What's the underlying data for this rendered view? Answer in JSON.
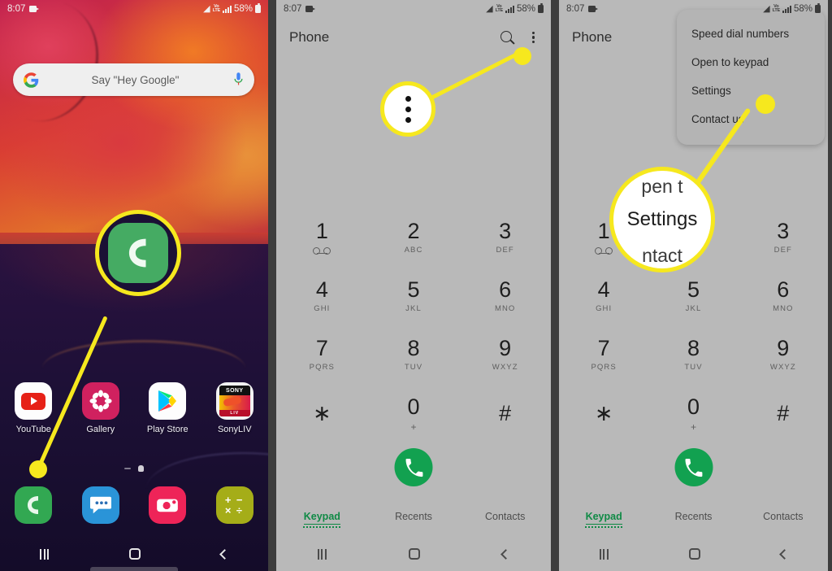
{
  "status_bar": {
    "time": "8:07",
    "battery_percent": "58%",
    "icons": [
      "camera-icon",
      "wifi-icon",
      "volte-icon",
      "signal-bars-icon",
      "battery-icon"
    ],
    "volte_top": "Vo",
    "volte_bottom": "LTE"
  },
  "panel1": {
    "name": "home-screen",
    "search": {
      "placeholder": "Say \"Hey Google\"",
      "logo": "google-g-icon",
      "mic": "microphone-icon"
    },
    "apps": [
      {
        "label": "YouTube",
        "icon": "youtube-icon"
      },
      {
        "label": "Gallery",
        "icon": "gallery-icon"
      },
      {
        "label": "Play Store",
        "icon": "play-store-icon"
      },
      {
        "label": "SonyLIV",
        "icon": "sonyliv-icon"
      }
    ],
    "sonyliv": {
      "top": "SONY",
      "bottom": "LIV"
    },
    "dock": [
      {
        "label": "Phone",
        "icon": "phone-icon"
      },
      {
        "label": "Messages",
        "icon": "messages-icon"
      },
      {
        "label": "Camera",
        "icon": "camera-app-icon"
      },
      {
        "label": "Calculator",
        "icon": "calculator-icon"
      }
    ],
    "nav": [
      "recents-icon",
      "home-icon",
      "back-icon"
    ]
  },
  "panel2": {
    "name": "phone-app-keypad",
    "title": "Phone",
    "actions": [
      "search-icon",
      "overflow-menu-icon"
    ],
    "keypad": [
      [
        {
          "digit": "1",
          "sub": "voicemail-icon"
        },
        {
          "digit": "2",
          "sub": "ABC"
        },
        {
          "digit": "3",
          "sub": "DEF"
        }
      ],
      [
        {
          "digit": "4",
          "sub": "GHI"
        },
        {
          "digit": "5",
          "sub": "JKL"
        },
        {
          "digit": "6",
          "sub": "MNO"
        }
      ],
      [
        {
          "digit": "7",
          "sub": "PQRS"
        },
        {
          "digit": "8",
          "sub": "TUV"
        },
        {
          "digit": "9",
          "sub": "WXYZ"
        }
      ],
      [
        {
          "digit": "∗",
          "sub": ""
        },
        {
          "digit": "0",
          "sub": "+"
        },
        {
          "digit": "#",
          "sub": ""
        }
      ]
    ],
    "call_button": "call-button",
    "tabs": [
      {
        "label": "Keypad",
        "active": true
      },
      {
        "label": "Recents",
        "active": false
      },
      {
        "label": "Contacts",
        "active": false
      }
    ]
  },
  "panel3": {
    "name": "phone-app-overflow-menu",
    "title": "Phone",
    "menu_items": [
      "Speed dial numbers",
      "Open to keypad",
      "Settings",
      "Contact us"
    ]
  },
  "callouts": {
    "panel1_magnifier": "phone-app-icon",
    "panel2_magnifier": "overflow-menu-icon",
    "panel3_magnifier": "Settings",
    "panel3_ghost_above": "pen t",
    "panel3_ghost_below": "ntact",
    "highlight_color": "#f6e81e"
  },
  "colors": {
    "accent_yellow": "#f6e81e",
    "phone_green": "#12a150",
    "tab_active_green": "#0f8a45",
    "app_bg": "#b9b9b9",
    "divider": "#3d3d3d"
  }
}
